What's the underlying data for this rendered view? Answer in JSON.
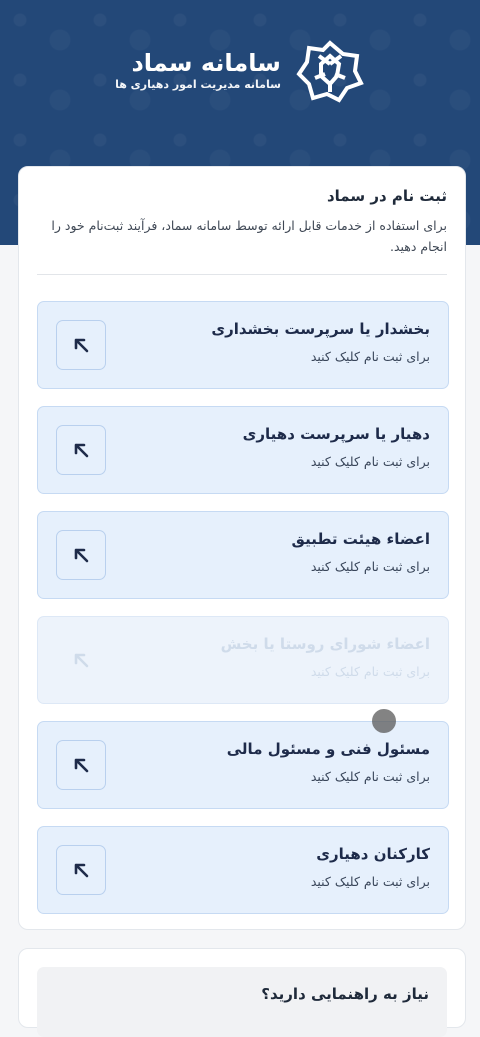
{
  "brand": {
    "title": "سامانه سماد",
    "subtitle": "سامانه مدیریت امور دهیاری ها"
  },
  "register": {
    "title": "ثبت نام در سماد",
    "description": "برای استفاده از خدمات قابل ارائه توسط سامانه سماد، فرآیند ثبت‌نام خود را انجام دهید."
  },
  "options": [
    {
      "title": "بخشدار یا سرپرست بخشداری",
      "subtitle": "برای ثبت نام کلیک کنید",
      "enabled": true
    },
    {
      "title": "دهیار یا سرپرست دهیاری",
      "subtitle": "برای ثبت نام کلیک کنید",
      "enabled": true
    },
    {
      "title": "اعضاء هیئت تطبیق",
      "subtitle": "برای ثبت نام کلیک کنید",
      "enabled": true
    },
    {
      "title": "اعضاء شورای روستا یا بخش",
      "subtitle": "برای ثبت نام کلیک کنید",
      "enabled": false
    },
    {
      "title": "مسئول فنی و مسئول مالی",
      "subtitle": "برای ثبت نام کلیک کنید",
      "enabled": true
    },
    {
      "title": "کارکنان دهیاری",
      "subtitle": "برای ثبت نام کلیک کنید",
      "enabled": true
    }
  ],
  "help": {
    "title": "نیاز به راهنمایی دارید؟"
  },
  "icons": {
    "logo": "samad-logo-icon",
    "option_arrow": "arrow-up-left-icon"
  },
  "colors": {
    "header": "#234878",
    "option_bg": "#e6f0fc",
    "option_border": "#c6daf3"
  }
}
